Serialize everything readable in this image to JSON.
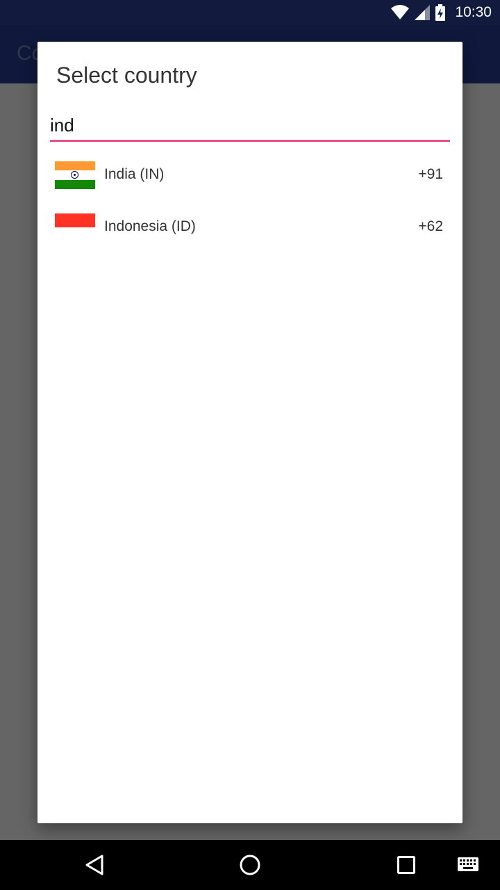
{
  "status_bar": {
    "time": "10:30",
    "icons": [
      "wifi-icon",
      "signal-icon",
      "battery-charging-icon"
    ]
  },
  "app_bar": {
    "title": "Co"
  },
  "dialog": {
    "title": "Select country",
    "search": {
      "value": "ind",
      "placeholder": ""
    },
    "countries": [
      {
        "name": "India (IN)",
        "code": "+91",
        "flag": "india-flag-icon"
      },
      {
        "name": "Indonesia (ID)",
        "code": "+62",
        "flag": "indonesia-flag-icon"
      }
    ]
  },
  "nav_bar": {
    "buttons": [
      "back-icon",
      "home-icon",
      "recents-icon",
      "keyboard-icon"
    ]
  },
  "colors": {
    "status_bar": "#121a3e",
    "app_bar": "#1e2d6e",
    "accent": "#e84f91",
    "scrim": "#656565"
  }
}
